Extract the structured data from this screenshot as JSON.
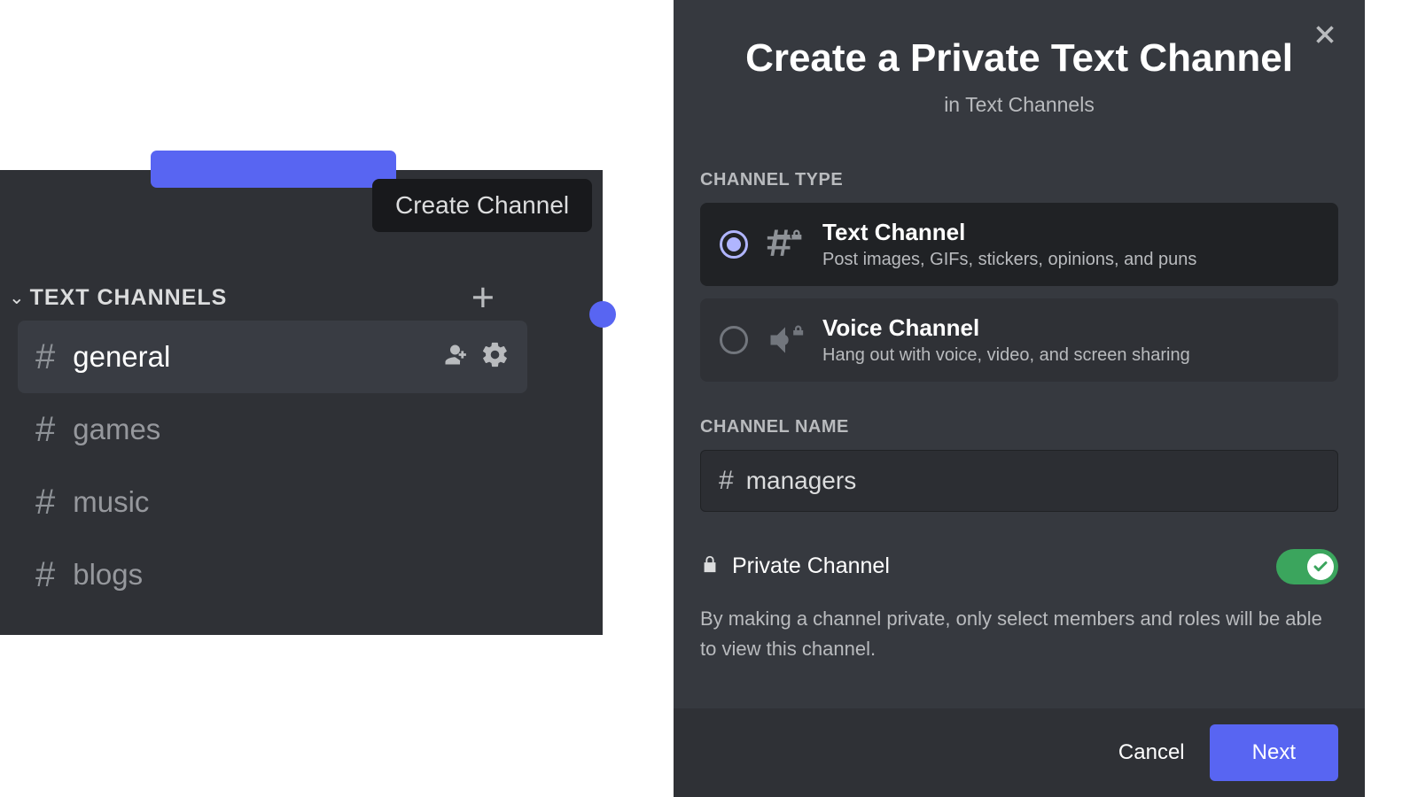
{
  "sidebar": {
    "tooltip": "Create Channel",
    "category_label": "TEXT CHANNELS",
    "channels": [
      {
        "name": "general",
        "selected": true
      },
      {
        "name": "games",
        "selected": false
      },
      {
        "name": "music",
        "selected": false
      },
      {
        "name": "blogs",
        "selected": false
      }
    ]
  },
  "modal": {
    "title": "Create a Private Text Channel",
    "subtitle": "in Text Channels",
    "section_type": "CHANNEL TYPE",
    "types": [
      {
        "title": "Text Channel",
        "desc": "Post images, GIFs, stickers, opinions, and puns",
        "selected": true
      },
      {
        "title": "Voice Channel",
        "desc": "Hang out with voice, video, and screen sharing",
        "selected": false
      }
    ],
    "section_name": "CHANNEL NAME",
    "name_value": "managers",
    "private_label": "Private Channel",
    "private_on": true,
    "private_desc": "By making a channel private, only select members and roles will be able to view this channel.",
    "cancel": "Cancel",
    "next": "Next"
  }
}
